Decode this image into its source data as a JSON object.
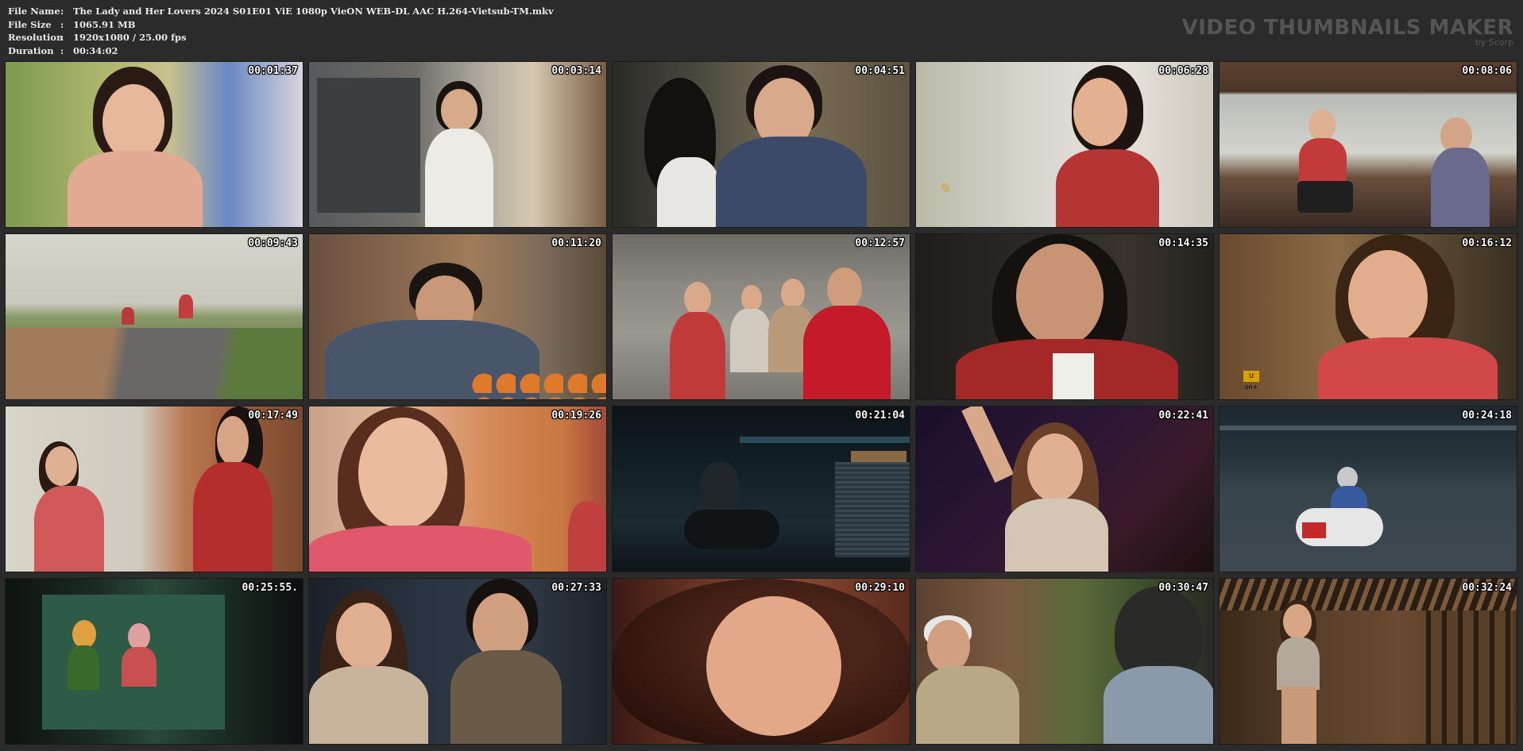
{
  "file_info": {
    "name_label": "File Name",
    "name_value": "The Lady and Her Lovers 2024 S01E01 ViE 1080p VieON WEB-DL AAC H.264-Vietsub-TM.mkv",
    "size_label": "File Size",
    "size_value": "1065.91 MB",
    "resolution_label": "Resolution",
    "resolution_value": "1920x1080 / 25.00 fps",
    "duration_label": "Duration",
    "duration_value": "00:34:02",
    "separator": ":"
  },
  "brand": {
    "title": "VIDEO THUMBNAILS MAKER",
    "subtitle": "by Scorp"
  },
  "thumbnails": [
    {
      "time": "00:01:37",
      "scene": "woman-market-daylight"
    },
    {
      "time": "00:03:14",
      "scene": "child-kitchen"
    },
    {
      "time": "00:04:51",
      "scene": "woman-hugging-child"
    },
    {
      "time": "00:06:28",
      "scene": "woman-red-shirt-sunlight"
    },
    {
      "time": "00:08:06",
      "scene": "street-food-stall"
    },
    {
      "time": "00:09:43",
      "scene": "cyclists-country-road"
    },
    {
      "time": "00:11:20",
      "scene": "man-fruit-stall"
    },
    {
      "time": "00:12:57",
      "scene": "market-group"
    },
    {
      "time": "00:14:35",
      "scene": "man-smiling-night"
    },
    {
      "time": "00:16:12",
      "scene": "woman-ponytail-closeup"
    },
    {
      "time": "00:17:49",
      "scene": "couple-temple"
    },
    {
      "time": "00:19:26",
      "scene": "woman-eyes-down"
    },
    {
      "time": "00:21:04",
      "scene": "night-street-motorbike"
    },
    {
      "time": "00:22:41",
      "scene": "woman-dancing-bar"
    },
    {
      "time": "00:24:18",
      "scene": "woman-scooter-dusk"
    },
    {
      "time": "00:25:55.",
      "scene": "dancers-window-night"
    },
    {
      "time": "00:27:33",
      "scene": "couple-night-sitting"
    },
    {
      "time": "00:29:10",
      "scene": "woman-lying-closeup"
    },
    {
      "time": "00:30:47",
      "scene": "old-man-uniform"
    },
    {
      "time": "00:32:24",
      "scene": "woman-wooden-house"
    }
  ],
  "channel_badge": "U on+"
}
